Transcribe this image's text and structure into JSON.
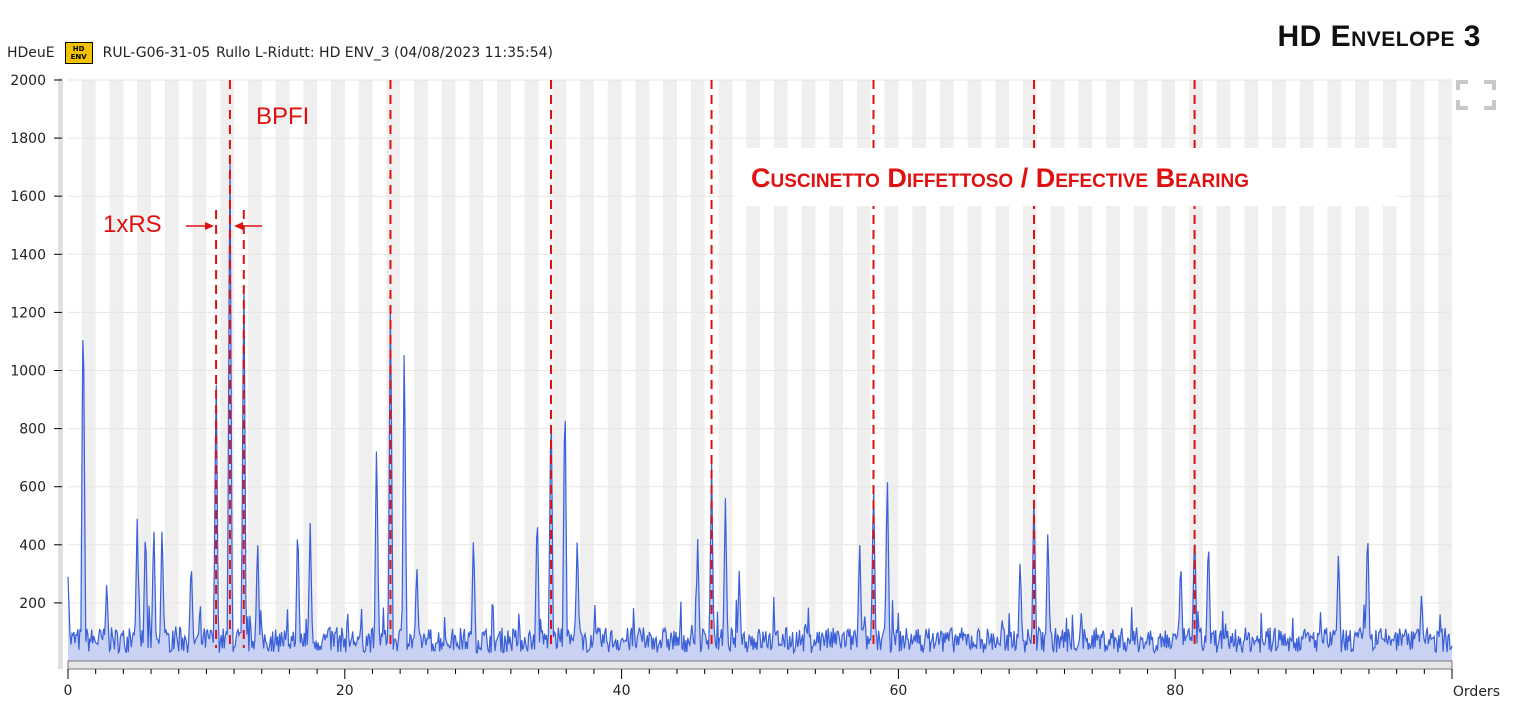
{
  "header": {
    "unit": "HDeuE",
    "badge_line1": "HD",
    "badge_line2": "ENV",
    "point": "RUL-G06-31-05",
    "description": "Rullo L-Ridutt: HD ENV_3 (04/08/2023 11:35:54)"
  },
  "big_title": "HD Envelope 3",
  "chart_data": {
    "type": "line",
    "xlabel": "Orders",
    "ylabel": "",
    "xlim": [
      0,
      100
    ],
    "ylim": [
      0,
      2000
    ],
    "x_ticks": [
      0,
      20,
      40,
      60,
      80
    ],
    "x_tick_labels": [
      "0",
      "20",
      "40",
      "60",
      "80"
    ],
    "y_ticks": [
      200,
      400,
      600,
      800,
      1000,
      1200,
      1400,
      1600,
      1800,
      2000
    ],
    "y_tick_labels": [
      "200",
      "400",
      "600",
      "800",
      "1000",
      "1200",
      "1400",
      "1600",
      "1800",
      "2000"
    ],
    "grid": true,
    "series_color": "#3a5fd6",
    "fill_color": "#c9d2f3",
    "marker_color": "#e01010",
    "peaks": [
      {
        "x": 0.0,
        "y": 250
      },
      {
        "x": 1.1,
        "y": 1265
      },
      {
        "x": 2.8,
        "y": 240
      },
      {
        "x": 5.0,
        "y": 450
      },
      {
        "x": 5.6,
        "y": 440
      },
      {
        "x": 6.2,
        "y": 440
      },
      {
        "x": 6.8,
        "y": 440
      },
      {
        "x": 8.9,
        "y": 320
      },
      {
        "x": 10.7,
        "y": 990
      },
      {
        "x": 11.7,
        "y": 1840
      },
      {
        "x": 12.7,
        "y": 1360
      },
      {
        "x": 13.7,
        "y": 390
      },
      {
        "x": 16.6,
        "y": 450
      },
      {
        "x": 17.5,
        "y": 435
      },
      {
        "x": 22.3,
        "y": 740
      },
      {
        "x": 23.3,
        "y": 1280
      },
      {
        "x": 24.3,
        "y": 1100
      },
      {
        "x": 25.2,
        "y": 300
      },
      {
        "x": 29.3,
        "y": 400
      },
      {
        "x": 33.9,
        "y": 500
      },
      {
        "x": 34.9,
        "y": 900
      },
      {
        "x": 35.9,
        "y": 935
      },
      {
        "x": 36.8,
        "y": 400
      },
      {
        "x": 45.5,
        "y": 380
      },
      {
        "x": 46.5,
        "y": 650
      },
      {
        "x": 47.5,
        "y": 520
      },
      {
        "x": 48.5,
        "y": 270
      },
      {
        "x": 57.2,
        "y": 390
      },
      {
        "x": 58.2,
        "y": 600
      },
      {
        "x": 59.2,
        "y": 625
      },
      {
        "x": 68.8,
        "y": 320
      },
      {
        "x": 69.8,
        "y": 560
      },
      {
        "x": 70.8,
        "y": 430
      },
      {
        "x": 80.4,
        "y": 320
      },
      {
        "x": 81.4,
        "y": 430
      },
      {
        "x": 82.4,
        "y": 400
      },
      {
        "x": 91.8,
        "y": 350
      },
      {
        "x": 93.9,
        "y": 435
      },
      {
        "x": 97.8,
        "y": 200
      }
    ],
    "noise_floor": 80,
    "bpfi_lines": [
      11.7,
      23.3,
      34.9,
      46.5,
      58.2,
      69.8,
      81.4
    ],
    "sideband_lines": [
      10.7,
      12.7
    ],
    "annotations": {
      "bpfi": "BPFI",
      "rs": "1xRS",
      "defect": "Cuscinetto Diffettoso / Defective Bearing"
    }
  }
}
